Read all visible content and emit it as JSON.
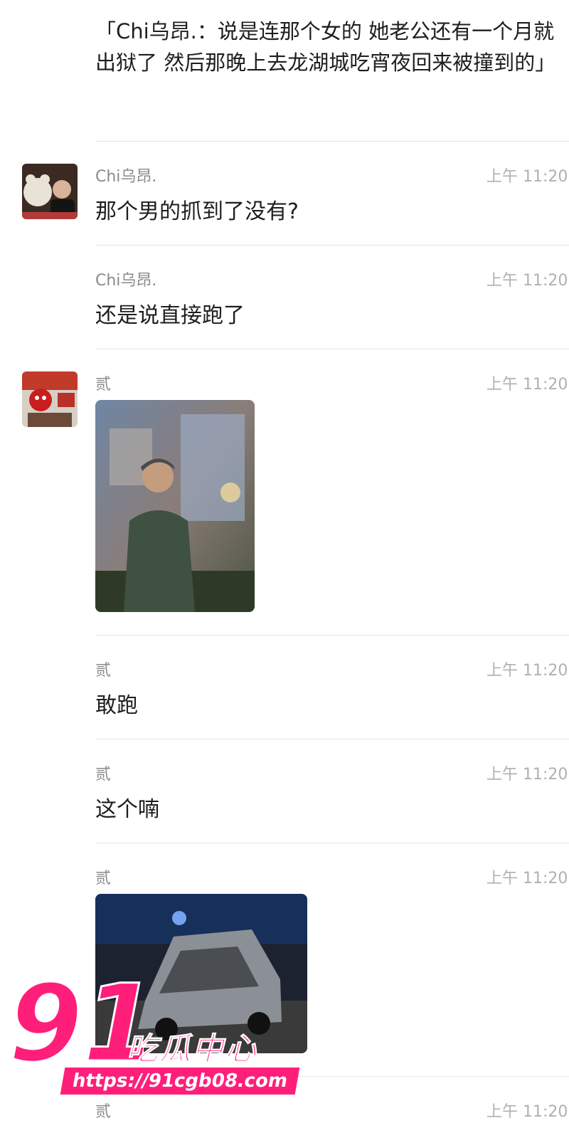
{
  "quote": "「Chi乌昂.：说是连那个女的 她老公还有一个月就出狱了 然后那晚上去龙湖城吃宵夜回来被撞到的」",
  "messages": [
    {
      "sender": "Chi乌昂.",
      "time": "上午 11:20",
      "text": "那个男的抓到了没有?"
    },
    {
      "sender": "Chi乌昂.",
      "time": "上午 11:20",
      "text": "还是说直接跑了"
    },
    {
      "sender": "贰",
      "time": "上午 11:20"
    },
    {
      "sender": "贰",
      "time": "上午 11:20",
      "text": "敢跑"
    },
    {
      "sender": "贰",
      "time": "上午 11:20",
      "text": "这个喃"
    },
    {
      "sender": "贰",
      "time": "上午 11:20"
    },
    {
      "sender": "贰",
      "time": "上午 11:20"
    }
  ],
  "watermark": {
    "number": "91",
    "label": "吃瓜中心",
    "url": "https://91cgb08.com"
  }
}
